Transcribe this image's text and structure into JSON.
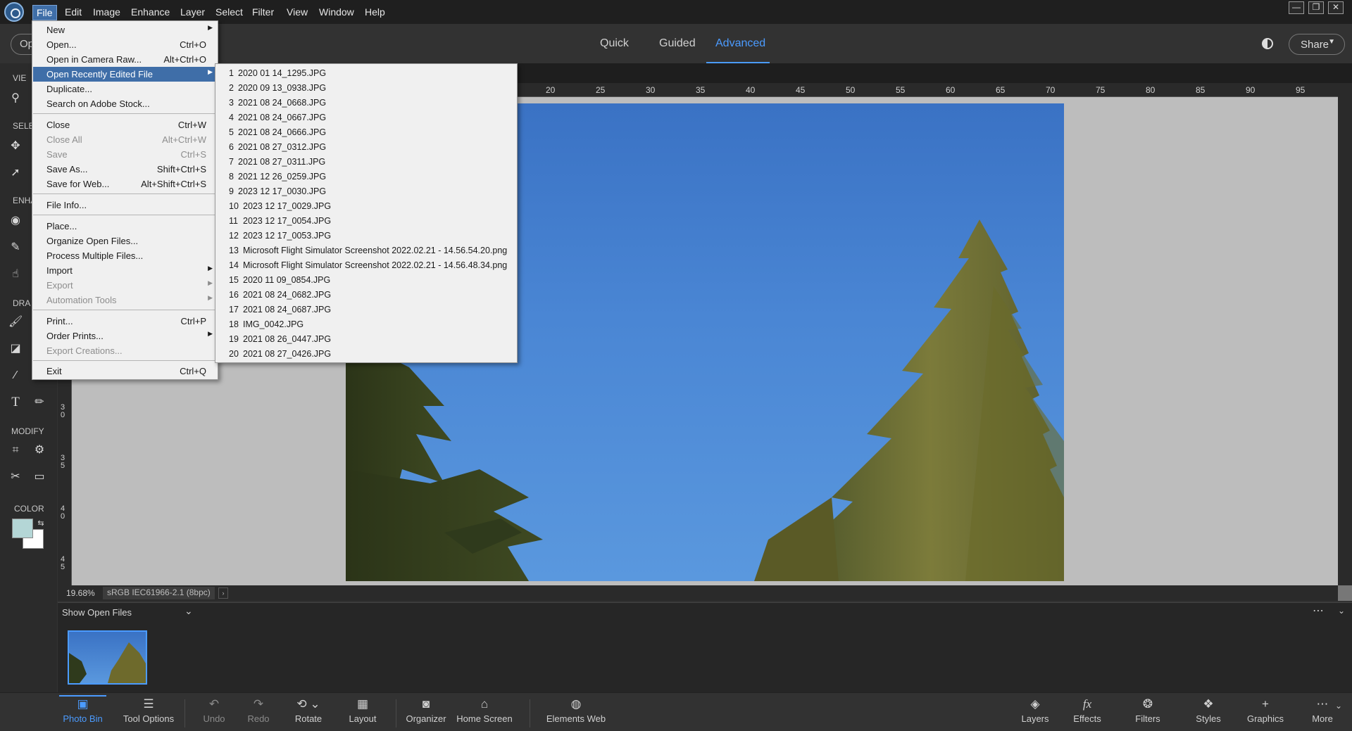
{
  "menubar": {
    "items": [
      "File",
      "Edit",
      "Image",
      "Enhance",
      "Layer",
      "Select",
      "Filter",
      "View",
      "Window",
      "Help"
    ],
    "window_controls": [
      "—",
      "❐",
      "✕"
    ]
  },
  "modebar": {
    "open_button": "Op",
    "tabs": [
      "Quick",
      "Guided",
      "Advanced"
    ],
    "active_tab": "Advanced",
    "share_label": "Share",
    "accent_color": "#4b9bff"
  },
  "toolbar": {
    "sections": [
      "VIE",
      "SELE",
      "ENHA",
      "DRA",
      "MODIFY",
      "COLOR"
    ],
    "foreground_color": "#b4d6d6",
    "background_color": "#ffffff"
  },
  "rulers": {
    "top": [
      "20",
      "25",
      "30",
      "35",
      "40",
      "45",
      "50",
      "55",
      "60",
      "65",
      "70",
      "75",
      "80",
      "85",
      "90",
      "95"
    ],
    "left": [
      "3\n0",
      "3\n5",
      "4\n0",
      "4\n5"
    ]
  },
  "status": {
    "zoom": "19.68%",
    "profile": "sRGB IEC61966-2.1 (8bpc)"
  },
  "bin": {
    "selector": "Show Open Files",
    "more": "⋯"
  },
  "bottombar": {
    "items": [
      {
        "icon": "photo-bin-icon",
        "label": "Photo Bin",
        "state": "active"
      },
      {
        "icon": "tool-options-icon",
        "label": "Tool Options",
        "state": "normal"
      },
      {
        "icon": "undo-icon",
        "label": "Undo",
        "state": "disabled"
      },
      {
        "icon": "redo-icon",
        "label": "Redo",
        "state": "disabled"
      },
      {
        "icon": "rotate-icon",
        "label": "Rotate",
        "state": "normal"
      },
      {
        "icon": "layout-icon",
        "label": "Layout",
        "state": "normal"
      },
      {
        "icon": "organizer-icon",
        "label": "Organizer",
        "state": "normal"
      },
      {
        "icon": "home-icon",
        "label": "Home Screen",
        "state": "normal"
      },
      {
        "icon": "globe-icon",
        "label": "Elements Web",
        "state": "normal"
      },
      {
        "icon": "layers-icon",
        "label": "Layers",
        "state": "normal"
      },
      {
        "icon": "fx-icon",
        "label": "Effects",
        "state": "normal"
      },
      {
        "icon": "filters-icon",
        "label": "Filters",
        "state": "normal"
      },
      {
        "icon": "styles-icon",
        "label": "Styles",
        "state": "normal"
      },
      {
        "icon": "plus-icon",
        "label": "Graphics",
        "state": "normal"
      },
      {
        "icon": "more-icon",
        "label": "More",
        "state": "normal"
      }
    ]
  },
  "file_menu": {
    "items": [
      {
        "label": "New",
        "shortcut": "",
        "submenu": true,
        "enabled": true
      },
      {
        "label": "Open...",
        "shortcut": "Ctrl+O",
        "enabled": true
      },
      {
        "label": "Open in Camera Raw...",
        "shortcut": "Alt+Ctrl+O",
        "enabled": true
      },
      {
        "label": "Open Recently Edited File",
        "shortcut": "",
        "submenu": true,
        "enabled": true,
        "highlighted": true
      },
      {
        "label": "Duplicate...",
        "shortcut": "",
        "enabled": true
      },
      {
        "label": "Search on Adobe Stock...",
        "shortcut": "",
        "enabled": true
      },
      {
        "label": "Close",
        "shortcut": "Ctrl+W",
        "enabled": true
      },
      {
        "label": "Close All",
        "shortcut": "Alt+Ctrl+W",
        "enabled": false
      },
      {
        "label": "Save",
        "shortcut": "Ctrl+S",
        "enabled": false
      },
      {
        "label": "Save As...",
        "shortcut": "Shift+Ctrl+S",
        "enabled": true
      },
      {
        "label": "Save for Web...",
        "shortcut": "Alt+Shift+Ctrl+S",
        "enabled": true
      },
      {
        "label": "File Info...",
        "shortcut": "",
        "enabled": true
      },
      {
        "label": "Place...",
        "shortcut": "",
        "enabled": true
      },
      {
        "label": "Organize Open Files...",
        "shortcut": "",
        "enabled": true
      },
      {
        "label": "Process Multiple Files...",
        "shortcut": "",
        "enabled": true
      },
      {
        "label": "Import",
        "shortcut": "",
        "submenu": true,
        "enabled": true
      },
      {
        "label": "Export",
        "shortcut": "",
        "submenu": true,
        "enabled": false
      },
      {
        "label": "Automation Tools",
        "shortcut": "",
        "submenu": true,
        "enabled": false
      },
      {
        "label": "Print...",
        "shortcut": "Ctrl+P",
        "enabled": true
      },
      {
        "label": "Order Prints...",
        "shortcut": "",
        "submenu": true,
        "enabled": true
      },
      {
        "label": "Export Creations...",
        "shortcut": "",
        "enabled": false
      },
      {
        "label": "Exit",
        "shortcut": "Ctrl+Q",
        "enabled": true
      }
    ]
  },
  "recent_files": [
    "2020 01 14_1295.JPG",
    "2020 09 13_0938.JPG",
    "2021 08 24_0668.JPG",
    "2021 08 24_0667.JPG",
    "2021 08 24_0666.JPG",
    "2021 08 27_0312.JPG",
    "2021 08 27_0311.JPG",
    "2021 12 26_0259.JPG",
    "2023 12 17_0030.JPG",
    "2023 12 17_0029.JPG",
    "2023 12 17_0054.JPG",
    "2023 12 17_0053.JPG",
    "Microsoft Flight Simulator Screenshot 2022.02.21 - 14.56.54.20.png",
    "Microsoft Flight Simulator Screenshot 2022.02.21 - 14.56.48.34.png",
    "2020 11 09_0854.JPG",
    "2021 08 24_0682.JPG",
    "2021 08 24_0687.JPG",
    "IMG_0042.JPG",
    "2021 08 26_0447.JPG",
    "2021 08 27_0426.JPG"
  ]
}
